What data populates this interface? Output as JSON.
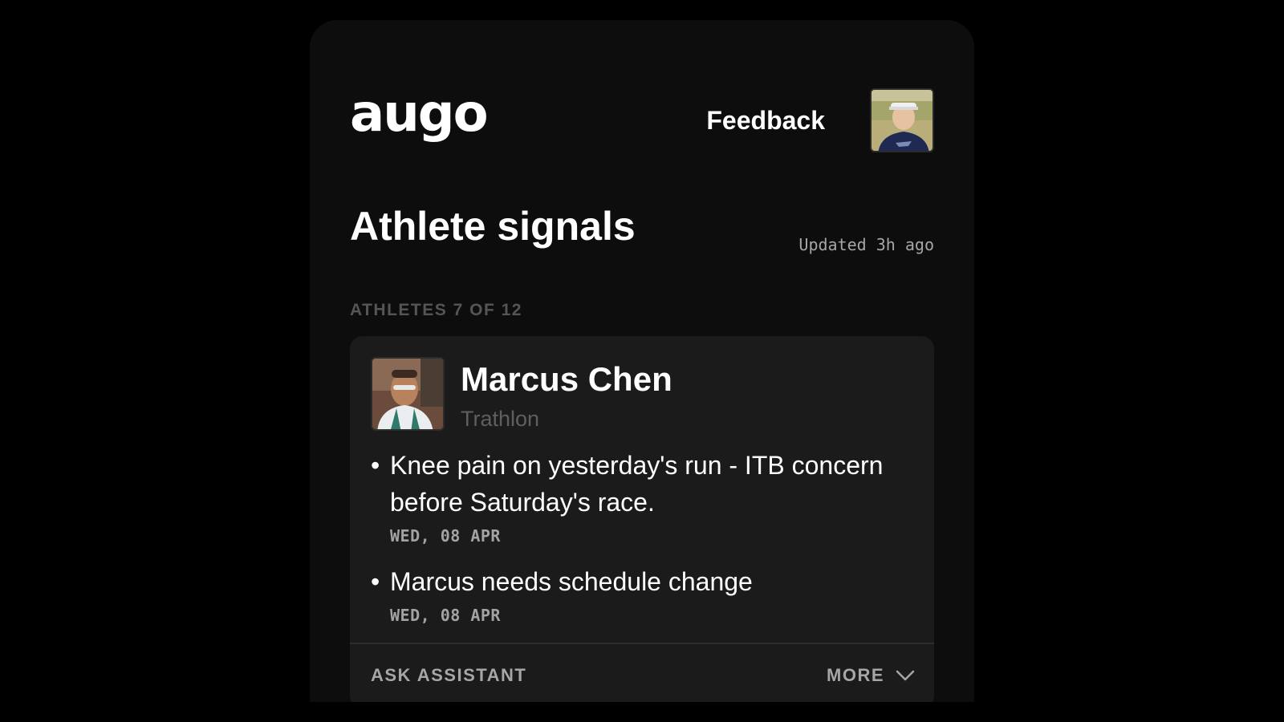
{
  "app": {
    "logo_text": "augo"
  },
  "header": {
    "feedback_label": "Feedback",
    "user_avatar_icon": "user-avatar"
  },
  "page": {
    "title": "Athlete signals",
    "updated": "Updated 3h ago",
    "count_label": "ATHLETES 7 OF 12"
  },
  "athlete": {
    "name": "Marcus Chen",
    "sport": "Trathlon",
    "signals": [
      {
        "text": "Knee pain on yesterday's run - ITB concern before Saturday's race.",
        "date": "WED, 08 APR"
      },
      {
        "text": "Marcus needs schedule change",
        "date": "WED, 08 APR"
      }
    ]
  },
  "card_footer": {
    "ask_label": "ASK ASSISTANT",
    "more_label": "MORE",
    "more_icon": "chevron-down-icon"
  }
}
